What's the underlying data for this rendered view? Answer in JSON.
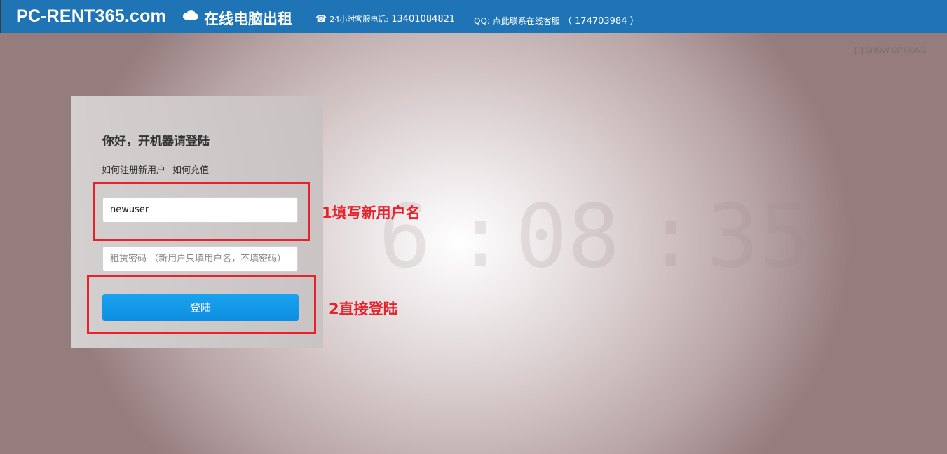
{
  "header": {
    "brand": "PC-RENT365.com",
    "brand_icon": "cloud-icon",
    "brand_cn": "在线电脑出租",
    "phone_icon": "phone-icon",
    "phone_label": "24小时客服电话:",
    "phone_number": "13401084821",
    "qq_label": "QQ: 点此联系在线客服",
    "qq_number": "（ 174703984 ）"
  },
  "show_options": "[+] SHOW OPTIONS",
  "login": {
    "title": "你好，开机器请登陆",
    "link_register": "如何注册新用户",
    "link_recharge": "如何充值",
    "username_value": "newuser",
    "password_placeholder": "租赁密码 （新用户只填用户名，不填密码）",
    "button_label": "登陆"
  },
  "annotations": {
    "step1": "1填写新用户名",
    "step2": "2直接登陆",
    "color": "#e8212b"
  },
  "clock": {
    "digits": [
      "6",
      ":",
      "08",
      ":",
      "35"
    ]
  },
  "colors": {
    "header_bg": "#1f74b5",
    "button_bg": "#0e8ee0"
  }
}
